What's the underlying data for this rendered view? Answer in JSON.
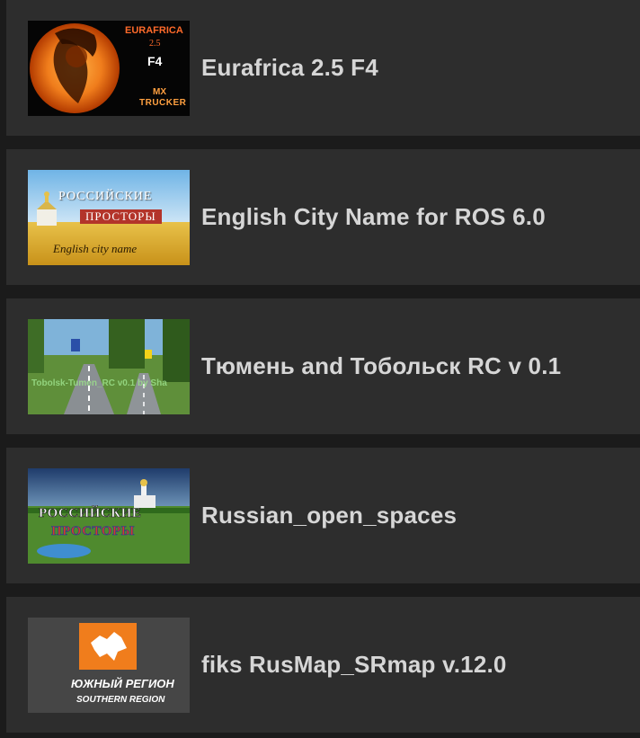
{
  "items": [
    {
      "title": "Eurafrica 2.5 F4",
      "thumb": {
        "line1": "EURAFRICA",
        "line2": "2.5",
        "line3": "F4",
        "logo1": "MX",
        "logo2": "TRUCKER"
      }
    },
    {
      "title": "English City Name for ROS 6.0",
      "thumb": {
        "line1": "РОССИЙСКИЕ",
        "line2": "ПРОСТОРЫ",
        "line3": "English city name"
      }
    },
    {
      "title": "Тюмень and Тобольск RC v 0.1",
      "thumb": {
        "line1": "Tobolsk-Tumen_RC v0.1 by Sha"
      }
    },
    {
      "title": "Russian_open_spaces",
      "thumb": {
        "line1": "РОССИЙСКИЕ",
        "line2": "ПРОСТОРЫ"
      }
    },
    {
      "title": "fiks RusMap_SRmap v.12.0",
      "thumb": {
        "line1": "ЮЖНЫЙ РЕГИОН",
        "line2": "SOUTHERN REGION"
      }
    }
  ],
  "colors": {
    "background": "#1b1b1b",
    "row": "#2d2d2d",
    "title": "#d6d6d6",
    "accent_orange": "#f07d1c"
  }
}
